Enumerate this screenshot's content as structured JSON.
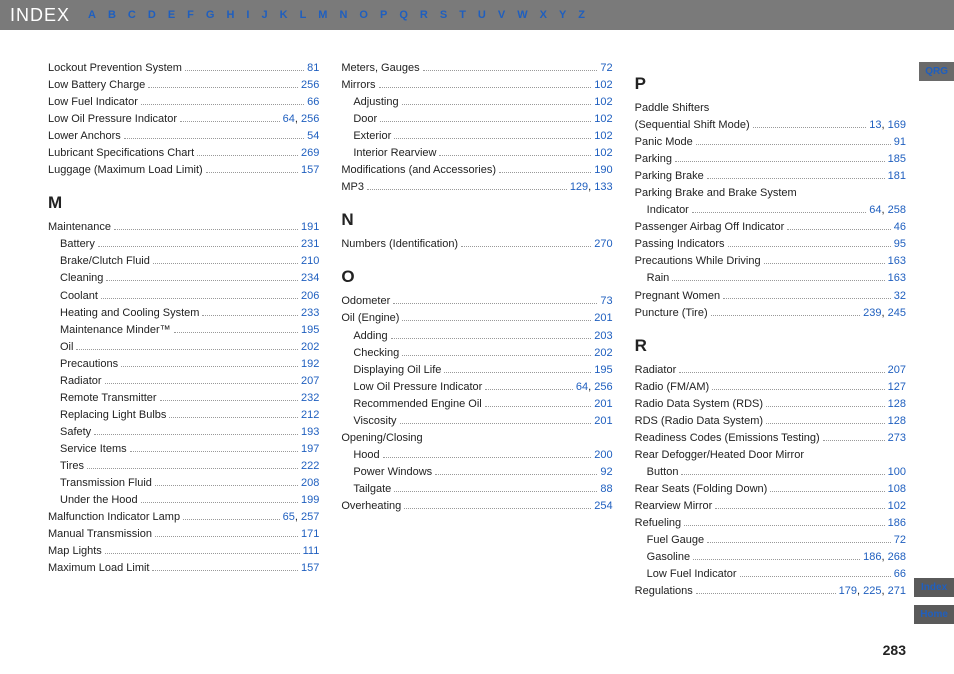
{
  "header": {
    "title": "INDEX",
    "letters": [
      "A",
      "B",
      "C",
      "D",
      "E",
      "F",
      "G",
      "H",
      "I",
      "J",
      "K",
      "L",
      "M",
      "N",
      "O",
      "P",
      "Q",
      "R",
      "S",
      "T",
      "U",
      "V",
      "W",
      "X",
      "Y",
      "Z"
    ]
  },
  "sideTabs": {
    "qrg": "QRG",
    "index": "Index",
    "home": "Home"
  },
  "pageNumber": "283",
  "columns": [
    [
      {
        "type": "entry",
        "label": "Lockout Prevention System",
        "pages": [
          "81"
        ]
      },
      {
        "type": "entry",
        "label": "Low Battery Charge",
        "pages": [
          "256"
        ]
      },
      {
        "type": "entry",
        "label": "Low Fuel Indicator",
        "pages": [
          "66"
        ]
      },
      {
        "type": "entry",
        "label": "Low Oil Pressure Indicator",
        "pages": [
          "64",
          "256"
        ]
      },
      {
        "type": "entry",
        "label": "Lower Anchors",
        "pages": [
          "54"
        ]
      },
      {
        "type": "entry",
        "label": "Lubricant Specifications Chart",
        "pages": [
          "269"
        ]
      },
      {
        "type": "entry",
        "label": "Luggage (Maximum Load Limit)",
        "pages": [
          "157"
        ]
      },
      {
        "type": "heading",
        "label": "M"
      },
      {
        "type": "entry",
        "label": "Maintenance",
        "pages": [
          "191"
        ]
      },
      {
        "type": "entry",
        "indent": 1,
        "label": "Battery",
        "pages": [
          "231"
        ]
      },
      {
        "type": "entry",
        "indent": 1,
        "label": "Brake/Clutch Fluid",
        "pages": [
          "210"
        ]
      },
      {
        "type": "entry",
        "indent": 1,
        "label": "Cleaning",
        "pages": [
          "234"
        ]
      },
      {
        "type": "entry",
        "indent": 1,
        "label": "Coolant",
        "pages": [
          "206"
        ]
      },
      {
        "type": "entry",
        "indent": 1,
        "label": "Heating and Cooling System",
        "pages": [
          "233"
        ]
      },
      {
        "type": "entry",
        "indent": 1,
        "label": "Maintenance Minder™",
        "pages": [
          "195"
        ]
      },
      {
        "type": "entry",
        "indent": 1,
        "label": "Oil",
        "pages": [
          "202"
        ]
      },
      {
        "type": "entry",
        "indent": 1,
        "label": "Precautions",
        "pages": [
          "192"
        ]
      },
      {
        "type": "entry",
        "indent": 1,
        "label": "Radiator",
        "pages": [
          "207"
        ]
      },
      {
        "type": "entry",
        "indent": 1,
        "label": "Remote Transmitter",
        "pages": [
          "232"
        ]
      },
      {
        "type": "entry",
        "indent": 1,
        "label": "Replacing Light Bulbs",
        "pages": [
          "212"
        ]
      },
      {
        "type": "entry",
        "indent": 1,
        "label": "Safety",
        "pages": [
          "193"
        ]
      },
      {
        "type": "entry",
        "indent": 1,
        "label": "Service Items",
        "pages": [
          "197"
        ]
      },
      {
        "type": "entry",
        "indent": 1,
        "label": "Tires",
        "pages": [
          "222"
        ]
      },
      {
        "type": "entry",
        "indent": 1,
        "label": "Transmission Fluid",
        "pages": [
          "208"
        ]
      },
      {
        "type": "entry",
        "indent": 1,
        "label": "Under the Hood",
        "pages": [
          "199"
        ]
      },
      {
        "type": "entry",
        "label": "Malfunction Indicator Lamp",
        "pages": [
          "65",
          "257"
        ]
      },
      {
        "type": "entry",
        "label": "Manual Transmission",
        "pages": [
          "171"
        ]
      },
      {
        "type": "entry",
        "label": "Map Lights",
        "pages": [
          "111"
        ]
      },
      {
        "type": "entry",
        "label": "Maximum Load Limit",
        "pages": [
          "157"
        ]
      }
    ],
    [
      {
        "type": "entry",
        "label": "Meters, Gauges",
        "pages": [
          "72"
        ]
      },
      {
        "type": "entry",
        "label": "Mirrors",
        "pages": [
          "102"
        ]
      },
      {
        "type": "entry",
        "indent": 1,
        "label": "Adjusting",
        "pages": [
          "102"
        ]
      },
      {
        "type": "entry",
        "indent": 1,
        "label": "Door",
        "pages": [
          "102"
        ]
      },
      {
        "type": "entry",
        "indent": 1,
        "label": "Exterior",
        "pages": [
          "102"
        ]
      },
      {
        "type": "entry",
        "indent": 1,
        "label": "Interior Rearview",
        "pages": [
          "102"
        ]
      },
      {
        "type": "entry",
        "label": "Modifications (and Accessories)",
        "pages": [
          "190"
        ]
      },
      {
        "type": "entry",
        "label": "MP3",
        "pages": [
          "129",
          "133"
        ]
      },
      {
        "type": "heading",
        "label": "N"
      },
      {
        "type": "entry",
        "label": "Numbers (Identification)",
        "pages": [
          "270"
        ]
      },
      {
        "type": "heading",
        "label": "O"
      },
      {
        "type": "entry",
        "label": "Odometer",
        "pages": [
          "73"
        ]
      },
      {
        "type": "entry",
        "label": "Oil (Engine)",
        "pages": [
          "201"
        ]
      },
      {
        "type": "entry",
        "indent": 1,
        "label": "Adding",
        "pages": [
          "203"
        ]
      },
      {
        "type": "entry",
        "indent": 1,
        "label": "Checking",
        "pages": [
          "202"
        ]
      },
      {
        "type": "entry",
        "indent": 1,
        "label": "Displaying Oil Life",
        "pages": [
          "195"
        ]
      },
      {
        "type": "entry",
        "indent": 1,
        "label": "Low Oil Pressure Indicator",
        "pages": [
          "64",
          "256"
        ]
      },
      {
        "type": "entry",
        "indent": 1,
        "label": "Recommended Engine Oil",
        "pages": [
          "201"
        ]
      },
      {
        "type": "entry",
        "indent": 1,
        "label": "Viscosity",
        "pages": [
          "201"
        ]
      },
      {
        "type": "entry",
        "label": "Opening/Closing",
        "pages": []
      },
      {
        "type": "entry",
        "indent": 1,
        "label": "Hood",
        "pages": [
          "200"
        ]
      },
      {
        "type": "entry",
        "indent": 1,
        "label": "Power Windows",
        "pages": [
          "92"
        ]
      },
      {
        "type": "entry",
        "indent": 1,
        "label": "Tailgate",
        "pages": [
          "88"
        ]
      },
      {
        "type": "entry",
        "label": "Overheating",
        "pages": [
          "254"
        ]
      }
    ],
    [
      {
        "type": "heading",
        "label": "P"
      },
      {
        "type": "entry",
        "label": "Paddle Shifters",
        "pages": []
      },
      {
        "type": "entry",
        "indent": 0,
        "label": "(Sequential Shift Mode)",
        "pages": [
          "13",
          "169"
        ]
      },
      {
        "type": "entry",
        "label": "Panic Mode",
        "pages": [
          "91"
        ]
      },
      {
        "type": "entry",
        "label": "Parking",
        "pages": [
          "185"
        ]
      },
      {
        "type": "entry",
        "label": "Parking Brake",
        "pages": [
          "181"
        ]
      },
      {
        "type": "entry",
        "label": "Parking Brake and Brake System",
        "pages": []
      },
      {
        "type": "entry",
        "indent": 1,
        "label": "Indicator",
        "pages": [
          "64",
          "258"
        ]
      },
      {
        "type": "entry",
        "label": "Passenger Airbag Off Indicator",
        "pages": [
          "46"
        ]
      },
      {
        "type": "entry",
        "label": "Passing Indicators",
        "pages": [
          "95"
        ]
      },
      {
        "type": "entry",
        "label": "Precautions While Driving",
        "pages": [
          "163"
        ]
      },
      {
        "type": "entry",
        "indent": 1,
        "label": "Rain",
        "pages": [
          "163"
        ]
      },
      {
        "type": "entry",
        "label": "Pregnant Women",
        "pages": [
          "32"
        ]
      },
      {
        "type": "entry",
        "label": "Puncture (Tire)",
        "pages": [
          "239",
          "245"
        ]
      },
      {
        "type": "heading",
        "label": "R"
      },
      {
        "type": "entry",
        "label": "Radiator",
        "pages": [
          "207"
        ]
      },
      {
        "type": "entry",
        "label": "Radio (FM/AM)",
        "pages": [
          "127"
        ]
      },
      {
        "type": "entry",
        "label": "Radio Data System (RDS)",
        "pages": [
          "128"
        ]
      },
      {
        "type": "entry",
        "label": "RDS (Radio Data System)",
        "pages": [
          "128"
        ]
      },
      {
        "type": "entry",
        "label": "Readiness Codes (Emissions Testing)",
        "pages": [
          "273"
        ]
      },
      {
        "type": "entry",
        "label": "Rear Defogger/Heated Door Mirror",
        "pages": []
      },
      {
        "type": "entry",
        "indent": 1,
        "label": "Button",
        "pages": [
          "100"
        ]
      },
      {
        "type": "entry",
        "label": "Rear Seats (Folding Down)",
        "pages": [
          "108"
        ]
      },
      {
        "type": "entry",
        "label": "Rearview Mirror",
        "pages": [
          "102"
        ]
      },
      {
        "type": "entry",
        "label": "Refueling",
        "pages": [
          "186"
        ]
      },
      {
        "type": "entry",
        "indent": 1,
        "label": "Fuel Gauge",
        "pages": [
          "72"
        ]
      },
      {
        "type": "entry",
        "indent": 1,
        "label": "Gasoline",
        "pages": [
          "186",
          "268"
        ]
      },
      {
        "type": "entry",
        "indent": 1,
        "label": "Low Fuel Indicator",
        "pages": [
          "66"
        ]
      },
      {
        "type": "entry",
        "label": "Regulations",
        "pages": [
          "179",
          "225",
          "271"
        ]
      }
    ]
  ]
}
